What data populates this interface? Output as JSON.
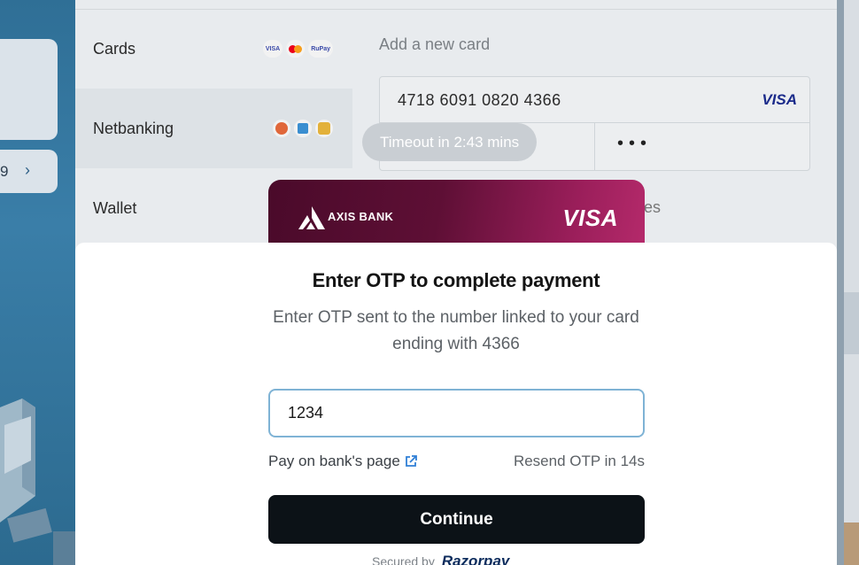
{
  "background": {
    "left_digit": "9",
    "left_chevron": "›"
  },
  "checkout": {
    "methods": [
      {
        "label": "Cards",
        "logos": [
          "VISA",
          "mastercard-logo",
          "RuPay"
        ]
      },
      {
        "label": "Netbanking",
        "logos": [
          "bank-logo-1",
          "bank-logo-2",
          "bank-logo-3"
        ]
      },
      {
        "label": "Wallet",
        "logos": []
      }
    ],
    "add_card_heading": "Add a new card",
    "card_number": "4718 6091 0820 4366",
    "card_network": "VISA",
    "cvv_masked": "•••",
    "names_fragment": "nes"
  },
  "timeout": {
    "text": "Timeout in 2:43 mins"
  },
  "bank_card": {
    "bank_name": "AXIS BANK",
    "network": "VISA"
  },
  "otp_modal": {
    "title": "Enter OTP to complete payment",
    "subtitle": "Enter OTP sent to the number linked to your card ending with 4366",
    "otp_value": "1234",
    "pay_on_bank_label": "Pay on bank's page",
    "resend_label": "Resend OTP in 14s",
    "continue_label": "Continue",
    "secured_by_label": "Secured by",
    "brand": "Razorpay"
  },
  "colors": {
    "continue_bg": "#0c1217",
    "input_border": "#7fb3d5",
    "card_gradient_start": "#4a0a2a",
    "card_gradient_end": "#b52a6b"
  }
}
